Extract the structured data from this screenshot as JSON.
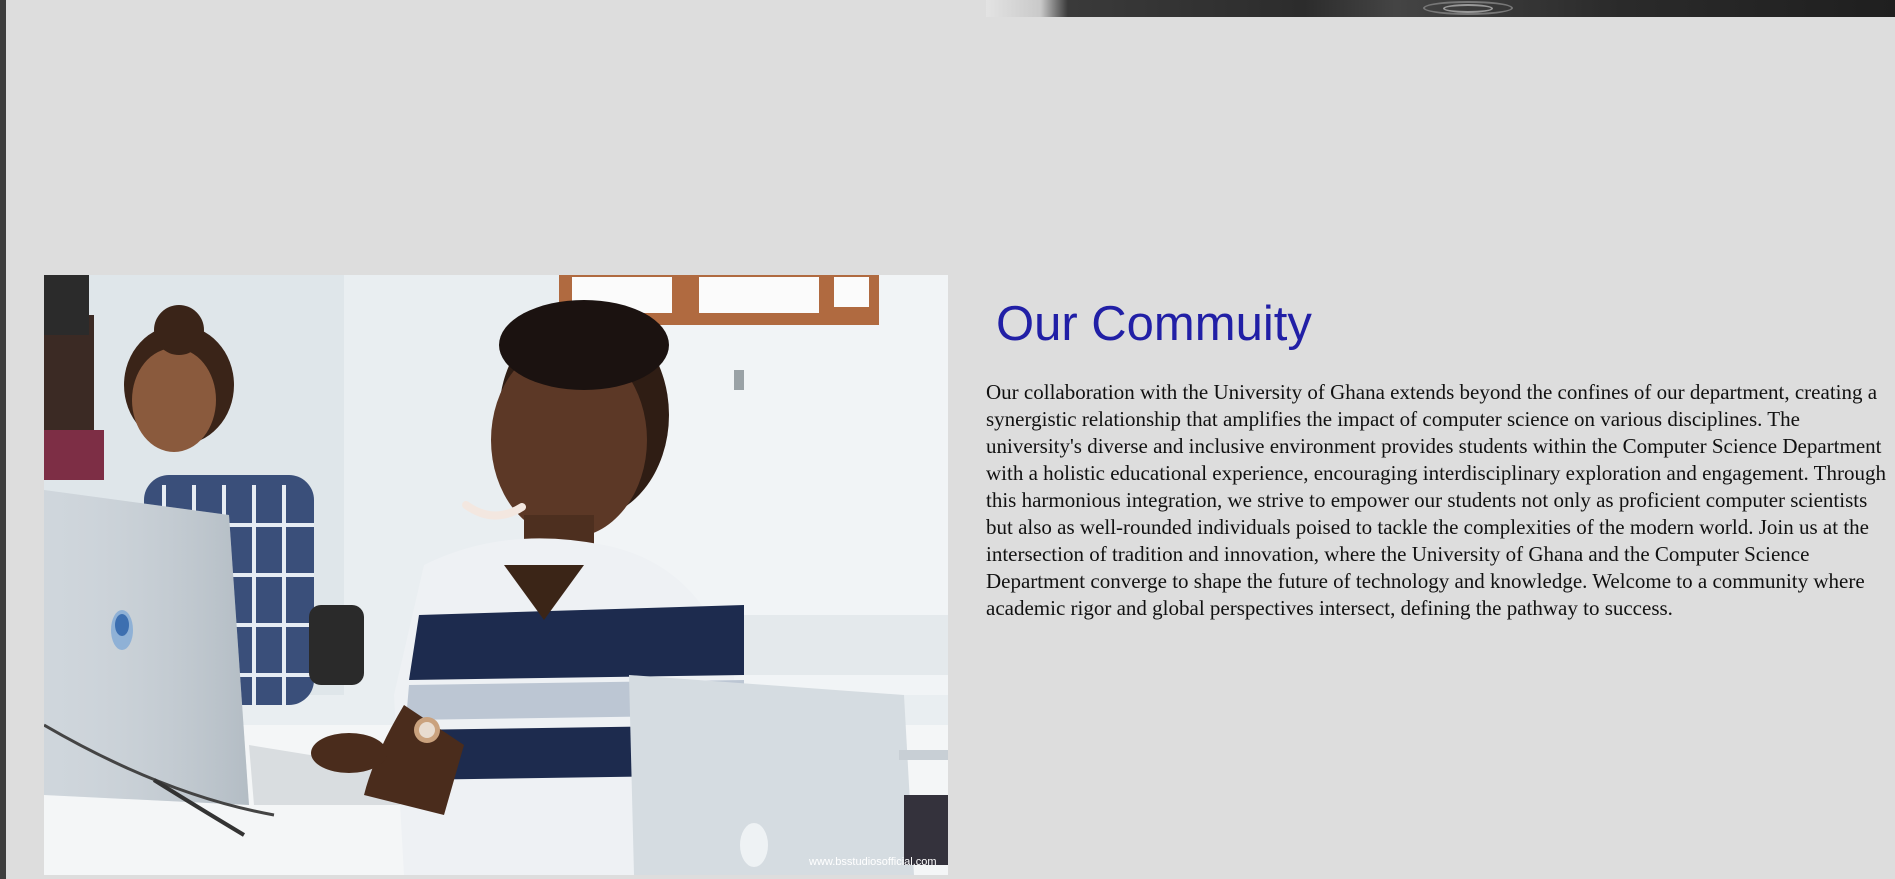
{
  "community": {
    "heading": "Our Commuity",
    "paragraph": "Our collaboration with the University of Ghana extends beyond the confines of our department, creating a synergistic relationship that amplifies the impact of computer science on various disciplines. The university's diverse and inclusive environment provides students within the Computer Science Department with a holistic educational experience, encouraging interdisciplinary exploration and engagement. Through this harmonious integration, we strive to empower our students not only as proficient computer scientists but also as well-rounded individuals poised to tackle the complexities of the modern world. Join us at the intersection of tradition and innovation, where the University of Ghana and the Computer Science Department converge to shape the future of technology and knowledge. Welcome to a community where academic rigor and global perspectives intersect, defining the pathway to success.",
    "photo_watermark": "www.bsstudiosofficial.com"
  },
  "colors": {
    "page_background": "#dddddd",
    "heading": "#211fa6",
    "body_text": "#111111"
  }
}
